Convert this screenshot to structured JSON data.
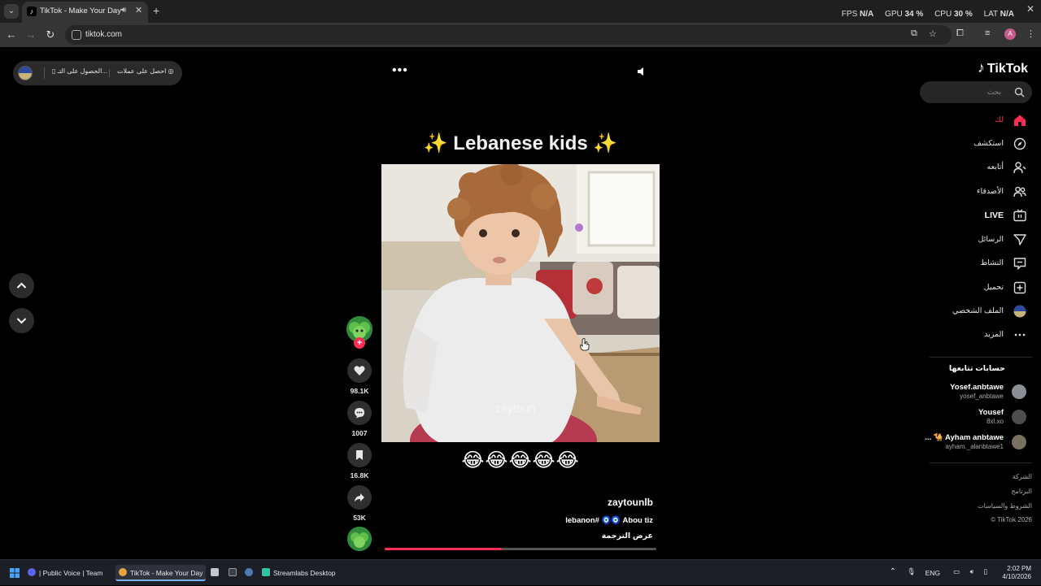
{
  "browser": {
    "tab_title": "TikTok - Make Your Day",
    "url": "tiktok.com",
    "perf": {
      "fps_label": "FPS",
      "fps_value": "N/A",
      "gpu_label": "GPU",
      "gpu_value": "34 %",
      "cpu_label": "CPU",
      "cpu_value": "30 %",
      "lat_label": "LAT",
      "lat_value": "N/A"
    },
    "profile_initial": "A"
  },
  "promo": {
    "get_coins": "احصل على عملات",
    "get_app": "الحصول على التـ..."
  },
  "video": {
    "title": "✨ Lebanese kids ✨",
    "watermark": "zaytoun",
    "caption_emoji": "😂😂😂😂😂",
    "author": "zaytounlb",
    "description": "lebanon# 🧿🧿 Abou tiz",
    "translate": "عرض الترجمة",
    "progress": 0.43
  },
  "actions": {
    "likes": "98.1K",
    "comments": "1007",
    "bookmarks": "16.8K",
    "shares": "53K"
  },
  "sidebar": {
    "logo": "TikTok",
    "search_placeholder": "بحث",
    "nav": [
      {
        "label": "لك"
      },
      {
        "label": "استكشف"
      },
      {
        "label": "أتابعه"
      },
      {
        "label": "الأصدقاء"
      },
      {
        "label": "LIVE"
      },
      {
        "label": "الرسائل"
      },
      {
        "label": "النشاط"
      },
      {
        "label": "تحميل"
      },
      {
        "label": "الملف الشخصي"
      },
      {
        "label": "المزيد"
      }
    ],
    "following_title": "حسابات تتابعها",
    "accounts": [
      {
        "name": "Yosef.anbtawe",
        "handle": "yosef_anbtawe"
      },
      {
        "name": "Yousef",
        "handle": "8xl.xo"
      },
      {
        "name": "... 🐪 Ayham anbtawe",
        "handle": "ayham._alanbtawe1"
      }
    ],
    "footer": [
      "الشركة",
      "البرنامج",
      "الشروط والسياسات",
      "© TikTok 2026"
    ]
  },
  "taskbar": {
    "apps": [
      {
        "label": "| Public Voice | Team"
      },
      {
        "label": "TikTok - Make Your Day"
      },
      {
        "label": "Streamlabs Desktop"
      }
    ],
    "lang": "ENG",
    "time": "2:02 PM",
    "date": "4/10/2026"
  }
}
